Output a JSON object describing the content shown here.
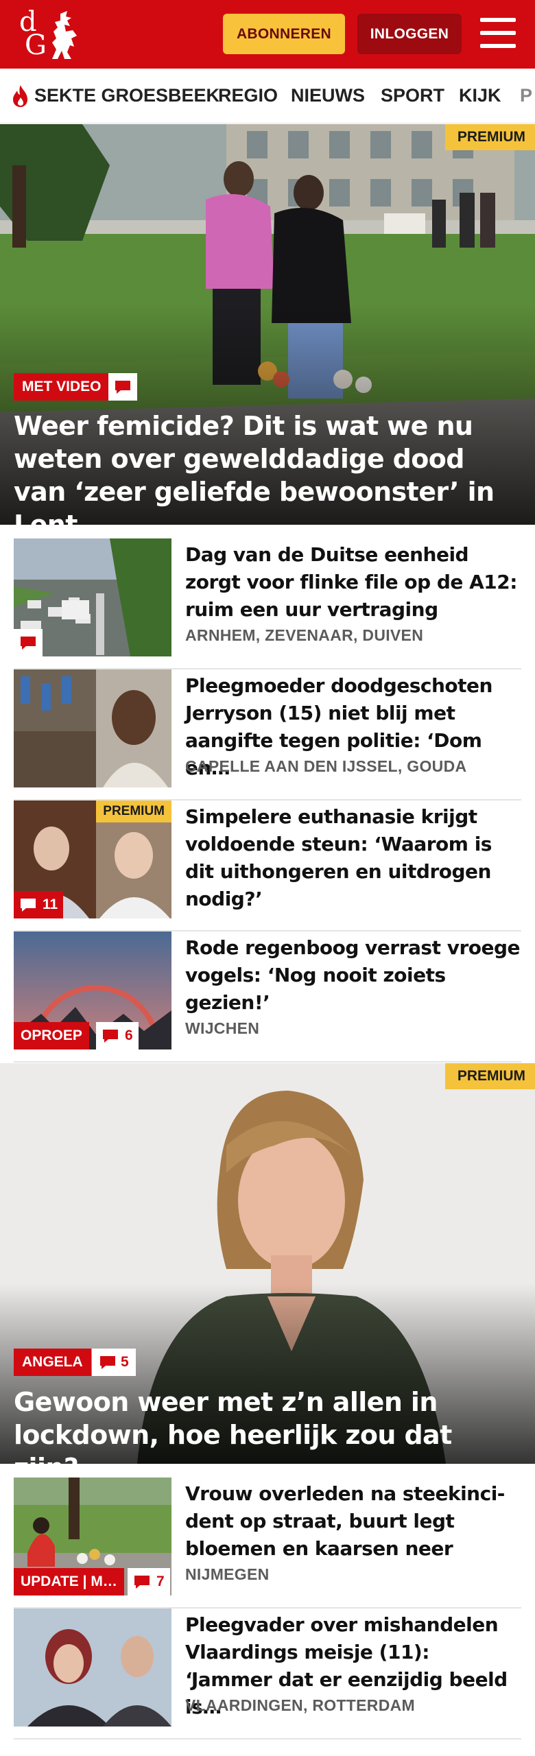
{
  "header": {
    "subscribe_label": "ABONNEREN",
    "login_label": "INLOGGEN",
    "brand_color": "#d10a11"
  },
  "nav": {
    "items": [
      "SEKTE GROESBEEK",
      "REGIO",
      "NIEUWS",
      "SPORT",
      "KIJK",
      "P"
    ]
  },
  "hero1": {
    "badge": "PREMIUM",
    "label": "MET VIDEO",
    "title": "Weer femicide? Dit is wat we nu weten over gewelddadige dood van ‘zeer geliefde bewoonster’ in Lent"
  },
  "articles": [
    {
      "title": "Dag van de Duitse eenheid zorgt voor flinke file op de A12: ruim een uur vertraging",
      "location": "ARNHEM, ZEVENAAR, DUIVEN",
      "comments": ""
    },
    {
      "title": "Pleegmoeder doodgeschoten Jerryson (15) niet blij met aangifte tegen politie: ‘Dom en…",
      "location": "CAPELLE AAN DEN IJSSEL, GOUDA"
    },
    {
      "title": "Simpelere euthanasie krijgt voldoende steun: ‘Waarom is dit uithongeren en uitdrogen nodig?’",
      "location": "",
      "badge": "PREMIUM",
      "comments": "11"
    },
    {
      "title": "Rode regenboog verrast vroege vogels: ‘Nog nooit zoiets gezien!’",
      "location": "WIJCHEN",
      "label": "OPROEP",
      "comments": "6"
    }
  ],
  "hero2": {
    "badge": "PREMIUM",
    "label": "ANGELA",
    "comments": "5",
    "title": "Gewoon weer met z’n allen in lockdown, hoe heerlijk zou dat zijn?"
  },
  "articles2": [
    {
      "title": "Vrouw overleden na steekinci-dent op straat, buurt legt bloemen en kaarsen neer",
      "location": "NIJMEGEN",
      "label": "UPDATE | M…",
      "comments": "7"
    },
    {
      "title": "Pleegvader over mishandelen Vlaardings meisje (11): ‘Jammer dat er eenzijdig beeld is…",
      "location": "VLAARDINGEN, ROTTERDAM"
    }
  ]
}
